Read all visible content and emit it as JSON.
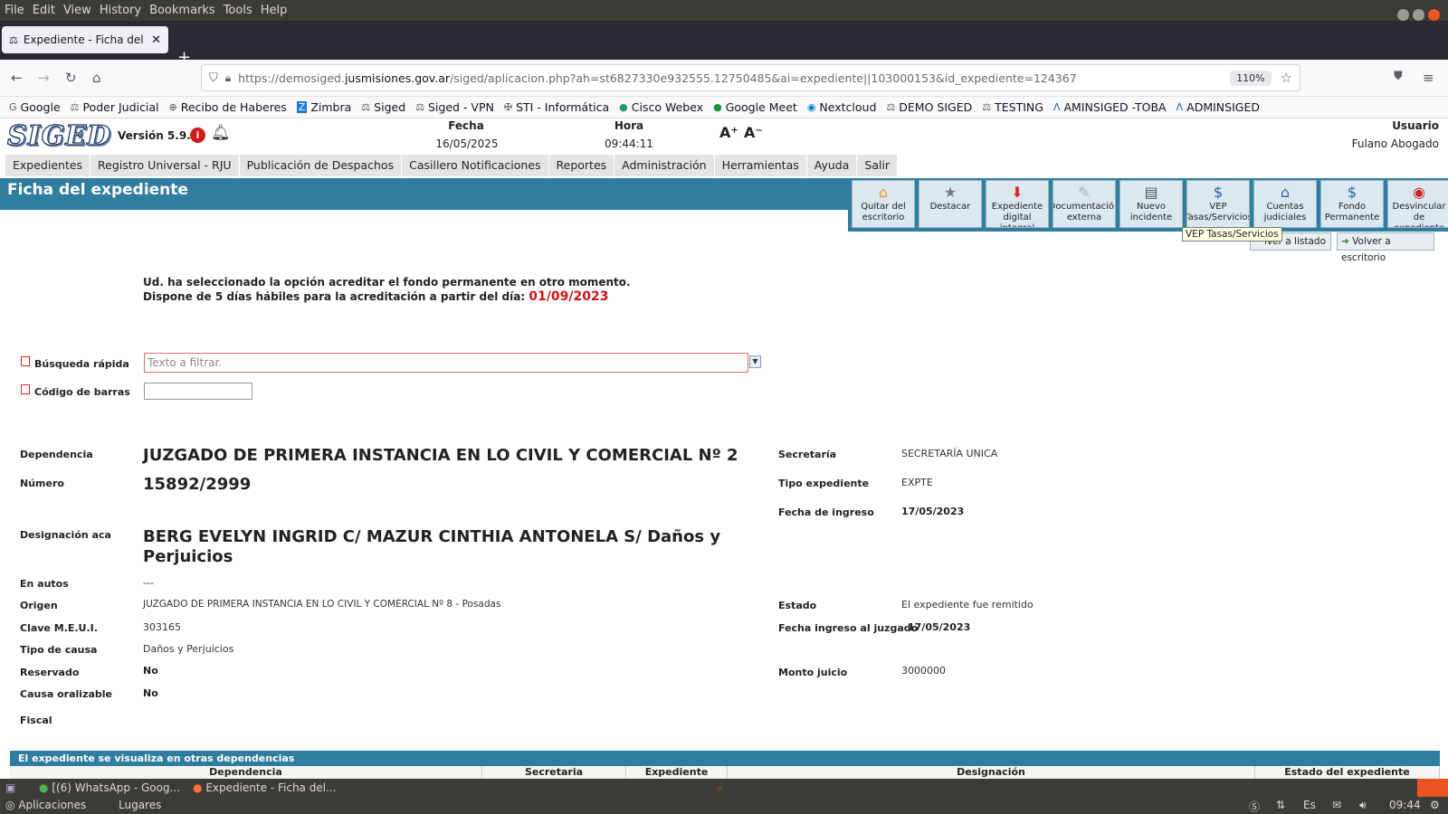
{
  "menubar": {
    "items": [
      "File",
      "Edit",
      "View",
      "History",
      "Bookmarks",
      "Tools",
      "Help"
    ]
  },
  "browser": {
    "tab_title": "Expediente - Ficha del ex",
    "url_prefix": "https://demosiged.",
    "url_domain": "jusmisiones.gov.ar",
    "url_rest": "/siged/aplicacion.php?ah=st6827330e932555.12750485&ai=expediente||103000153&id_expediente=124367",
    "zoom": "110%"
  },
  "bookmarks": [
    "Google",
    "Poder Judicial",
    "Recibo de Haberes",
    "Zimbra",
    "Siged",
    "Siged - VPN",
    "STI - Informática",
    "Cisco Webex",
    "Google Meet",
    "Nextcloud",
    "DEMO SIGED",
    "TESTING",
    "AMINSIGED -TOBA",
    "ADMINSIGED"
  ],
  "header": {
    "logo": "SIGED",
    "version": "Versión 5.9.1",
    "fecha_label": "Fecha",
    "fecha_value": "16/05/2025",
    "hora_label": "Hora",
    "hora_value": "09:44:11",
    "font_up": "A⁺",
    "font_down": "A⁻",
    "usuario_label": "Usuario",
    "usuario_value": "Fulano Abogado"
  },
  "nav": [
    "Expedientes",
    "Registro Universal - RJU",
    "Publicación de Despachos",
    "Casillero Notificaciones",
    "Reportes",
    "Administración",
    "Herramientas",
    "Ayuda",
    "Salir"
  ],
  "page_title": "Ficha del expediente",
  "toolbar": [
    {
      "label": "Quitar del escritorio",
      "icon": "⌂"
    },
    {
      "label": "Destacar",
      "icon": "★"
    },
    {
      "label": "Expediente digital integral",
      "icon": "⬇"
    },
    {
      "label": "Documentación externa",
      "icon": "✎"
    },
    {
      "label": "Nuevo incidente",
      "icon": "▤"
    },
    {
      "label": "VEP Tasas/Servicios",
      "icon": "$"
    },
    {
      "label": "Cuentas judiciales",
      "icon": "⌂"
    },
    {
      "label": "Fondo Permanente",
      "icon": "$"
    },
    {
      "label": "Desvincular de expediente",
      "icon": "◉"
    }
  ],
  "tooltip": "VEP Tasas/Servicios",
  "volver_listado": "lver a listado",
  "volver_escritorio": "Volver a escritorio",
  "message": {
    "line1": "Ud. ha seleccionado la opción acreditar el fondo permanente en otro momento.",
    "line2": "Dispone de 5 días hábiles para la acreditación a partir del día:",
    "date": "01/09/2023"
  },
  "search": {
    "quick_label": "Búsqueda rápida",
    "quick_placeholder": "Texto a filtrar.",
    "barcode_label": "Código de barras"
  },
  "fields": {
    "dependencia_label": "Dependencia",
    "dependencia": "JUZGADO DE PRIMERA INSTANCIA EN LO CIVIL Y COMERCIAL Nº 2",
    "numero_label": "Número",
    "numero": "15892/2999",
    "designacion_label": "Designación aca",
    "designacion": "BERG EVELYN INGRID C/ MAZUR CINTHIA ANTONELA S/ Daños y Perjuicios",
    "en_autos_label": "En autos",
    "en_autos": "---",
    "origen_label": "Origen",
    "origen": "JUZGADO DE PRIMERA INSTANCIA EN LO CIVIL Y COMERCIAL Nº 8 - Posadas",
    "clave_label": "Clave M.E.U.I.",
    "clave": "303165",
    "tipo_causa_label": "Tipo de causa",
    "tipo_causa": "Daños y Perjuicios",
    "reservado_label": "Reservado",
    "reservado": "No",
    "oralizable_label": "Causa oralizable",
    "oralizable": "No",
    "fiscal_label": "Fiscal",
    "secretaria_label": "Secretaría",
    "secretaria": "SECRETARÍA UNICA",
    "tipo_exp_label": "Tipo expediente",
    "tipo_exp": "EXPTE",
    "fecha_ingreso_label": "Fecha de ingreso",
    "fecha_ingreso": "17/05/2023",
    "estado_label": "Estado",
    "estado": "El expediente fue remitido",
    "fecha_juzgado_label": "Fecha ingreso al juzgado",
    "fecha_juzgado": "17/05/2023",
    "monto_label": "Monto juicio",
    "monto": "3000000"
  },
  "otras": {
    "title": "El expediente se visualiza en otras dependencias",
    "columns": [
      "Dependencia",
      "Secretaria",
      "Expediente",
      "Designación",
      "Estado del expediente"
    ]
  },
  "taskbar": {
    "item1": "[(6) WhatsApp - Goog...",
    "item2": "Expediente - Ficha del..."
  },
  "bottombar": {
    "apps": "Aplicaciones",
    "places": "Lugares",
    "time": "09:44",
    "lang": "Es"
  }
}
